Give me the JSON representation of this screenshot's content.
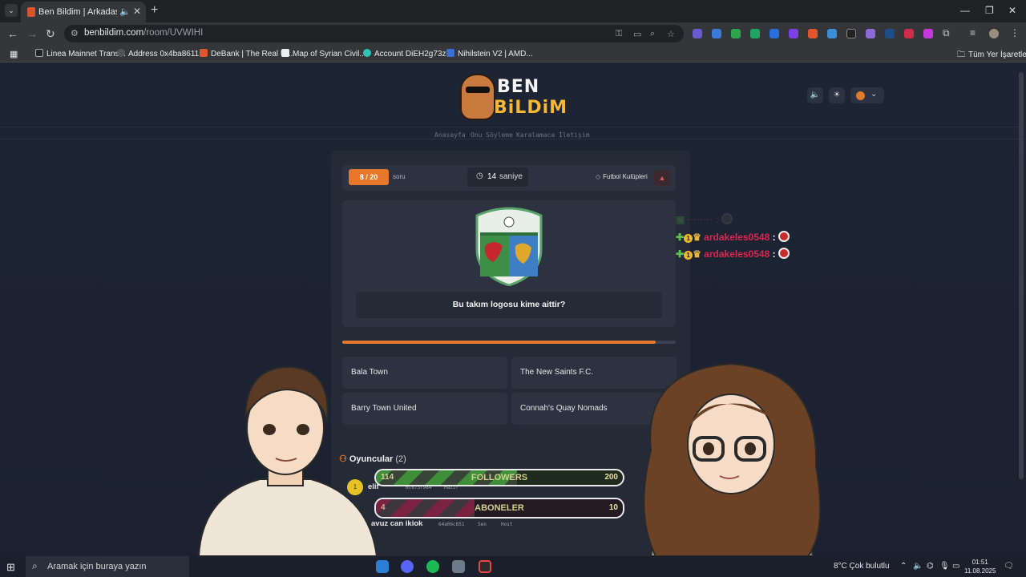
{
  "browser": {
    "tab_title": "Ben Bildim | Arkadaşlarınla Oyna",
    "url_host": "benbildim.com",
    "url_path": "/room/UVWIHI",
    "bookmarks": [
      "Linea Mainnet Trans...",
      "Address 0x4ba8611...",
      "DeBank | The Real U...",
      "Map of Syrian Civil...",
      "Account DiEH2g73z...",
      "Nihilstein V2 | AMD..."
    ],
    "all_bookmarks": "Tüm Yer İşaretleri"
  },
  "site": {
    "logo_line1": "BEN",
    "logo_line2": "BiLDiM",
    "nav": [
      "Anasayfa",
      "Onu Söyleme",
      "Karalamaca",
      "İletişim"
    ]
  },
  "game": {
    "progress": "8 / 20",
    "progress_fraction": 0.4,
    "progress_suffix": "soru",
    "timer_value": "14",
    "timer_unit": "saniye",
    "category": "Futbol Kulüpleri",
    "question": "Bu takım logosu kime aittir?",
    "time_bar_fraction": 0.94,
    "options": [
      "Bala Town",
      "The New Saints F.C.",
      "Barry Town United",
      "Connah's Quay Nomads"
    ],
    "players_label": "Oyuncular",
    "players_count": "(2)",
    "players": [
      {
        "rank": "1",
        "name": "elif",
        "id": "6c873f984",
        "status": "Hazır"
      },
      {
        "name": "avuz can ikiok",
        "id": "64a06c851",
        "tag1": "Sen",
        "tag2": "Host"
      }
    ]
  },
  "overlay": {
    "chat": [
      {
        "user": "ardakeles0548",
        "badge": "1"
      },
      {
        "user": "ardakeles0548",
        "badge": "1"
      }
    ],
    "goals": [
      {
        "label": "FOLLOWERS",
        "current": "114",
        "max": "200",
        "fraction": 0.57,
        "color": "#3f8f3a"
      },
      {
        "label": "ABONELER",
        "current": "4",
        "max": "10",
        "fraction": 0.4,
        "color": "#7a2240"
      }
    ]
  },
  "taskbar": {
    "search_placeholder": "Aramak için buraya yazın",
    "weather": "8°C  Çok bulutlu",
    "time": "01:51",
    "date": "11.08.2025"
  },
  "colors": {
    "accent": "#e7772b",
    "page_bg": "#1c2230",
    "card_bg": "#242a36",
    "chat_user": "#e0244f"
  }
}
